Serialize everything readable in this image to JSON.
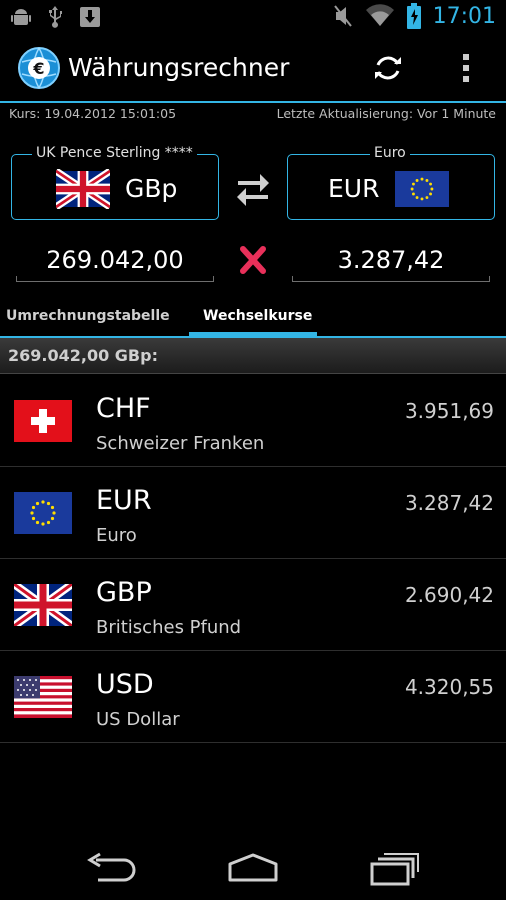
{
  "status_bar": {
    "time": "17:01",
    "icons": [
      "android-debug-icon",
      "usb-icon",
      "download-icon",
      "muted-icon",
      "wifi-icon",
      "battery-charging-icon"
    ],
    "accent": "#33b5e5"
  },
  "action_bar": {
    "title": "Währungsrechner",
    "icons": [
      "euro-globe-logo",
      "refresh-icon",
      "overflow-menu-icon"
    ]
  },
  "info": {
    "rate_date": "Kurs: 19.04.2012 15:01:05",
    "last_update": "Letzte Aktualisierung: Vor 1 Minute"
  },
  "converter": {
    "from": {
      "label": "UK Pence Sterling ****",
      "code": "GBp",
      "flag": "uk-flag",
      "amount": "269.042,00"
    },
    "to": {
      "label": "Euro",
      "code": "EUR",
      "flag": "eu-flag",
      "amount": "3.287,42"
    },
    "clear_color": "#e8305a"
  },
  "tabs": [
    {
      "label": "Umrechnungstabelle",
      "active": false
    },
    {
      "label": "Wechselkurse",
      "active": true
    }
  ],
  "list": {
    "header": "269.042,00 GBp:",
    "items": [
      {
        "code": "CHF",
        "name": "Schweizer Franken",
        "value": "3.951,69",
        "flag": "swiss-flag"
      },
      {
        "code": "EUR",
        "name": "Euro",
        "value": "3.287,42",
        "flag": "eu-flag"
      },
      {
        "code": "GBP",
        "name": "Britisches Pfund",
        "value": "2.690,42",
        "flag": "uk-flag"
      },
      {
        "code": "USD",
        "name": "US Dollar",
        "value": "4.320,55",
        "flag": "us-flag"
      }
    ]
  },
  "nav_bar": {
    "icons": [
      "back-icon",
      "home-icon",
      "recent-apps-icon"
    ]
  }
}
